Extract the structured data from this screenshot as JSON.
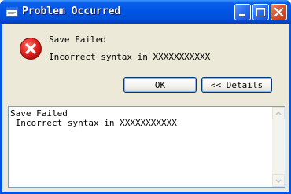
{
  "window": {
    "title": "Problem Occurred",
    "controls": [
      "minimize-icon",
      "maximize-icon",
      "close-icon"
    ]
  },
  "message": {
    "icon": "error-icon",
    "heading": "Save Failed",
    "detail": "Incorrect syntax in XXXXXXXXXXX"
  },
  "buttons": {
    "ok_label": "OK",
    "details_label": "<< Details"
  },
  "details": {
    "text": "Save Failed\n Incorrect syntax in XXXXXXXXXXX"
  },
  "colors": {
    "titlebar": "#0055e5",
    "dialog_bg": "#ece9d8",
    "error_red": "#e0201e"
  }
}
